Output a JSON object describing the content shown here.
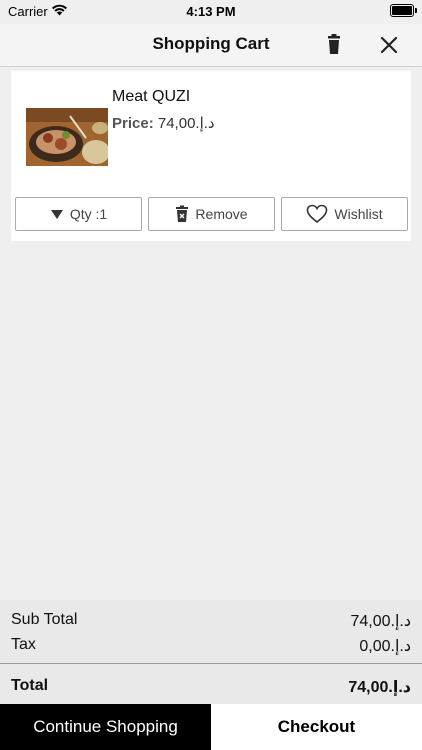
{
  "status_bar": {
    "carrier": "Carrier",
    "time": "4:13 PM"
  },
  "nav": {
    "title": "Shopping Cart"
  },
  "cart": {
    "items": [
      {
        "name": "Meat QUZI",
        "price_label": "Price:",
        "price": "74,00.د.إ",
        "qty_label": "Qty :1",
        "remove_label": "Remove",
        "wishlist_label": "Wishlist"
      }
    ]
  },
  "summary": {
    "subtotal_label": "Sub Total",
    "subtotal_value": "74,00.د.إ",
    "tax_label": "Tax",
    "tax_value": "0,00.د.إ",
    "total_label": "Total",
    "total_value": "74,00.د.إ"
  },
  "actions": {
    "continue_label": "Continue Shopping",
    "checkout_label": "Checkout"
  }
}
